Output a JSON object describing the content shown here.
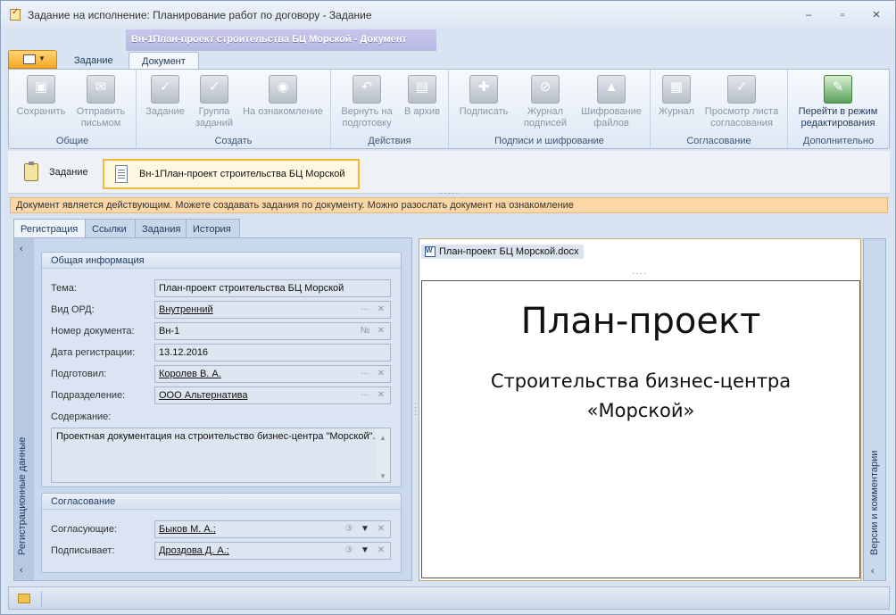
{
  "window": {
    "title": "Задание на исполнение: Планирование работ по договору - Задание",
    "controls": [
      "‒",
      "▫",
      "✕"
    ]
  },
  "context_tab": {
    "title": "Вн-1План-проект строительства БЦ Морской - Документ"
  },
  "ribbon_tabs": [
    "Задание",
    "Документ"
  ],
  "ribbon": {
    "groups": [
      {
        "label": "Общие",
        "buttons": [
          "Сохранить",
          "Отправить письмом"
        ]
      },
      {
        "label": "Создать",
        "buttons": [
          "Задание",
          "Группа заданий",
          "На ознакомление"
        ]
      },
      {
        "label": "Действия",
        "buttons": [
          "Вернуть на подготовку",
          "В архив"
        ]
      },
      {
        "label": "Подписи и шифрование",
        "buttons": [
          "Подписать",
          "Журнал подписей",
          "Шифрование файлов"
        ]
      },
      {
        "label": "Согласование",
        "buttons": [
          "Журнал",
          "Просмотр листа согласования"
        ]
      },
      {
        "label": "Дополнительно",
        "buttons": [
          "Перейти в режим редактирования"
        ]
      }
    ]
  },
  "breadcrumbs": {
    "task": "Задание",
    "document": "Вн-1План-проект строительства БЦ Морской"
  },
  "info_message": "Документ является действующим. Можете создавать задания по документу. Можно разослать документ на ознакомление",
  "form_tabs": [
    "Регистрация",
    "Ссылки",
    "Задания",
    "История"
  ],
  "side_label": "Регистрационные данные",
  "general": {
    "header": "Общая информация",
    "fields": {
      "topic": {
        "label": "Тема:",
        "value": "План-проект строительства БЦ Морской"
      },
      "ord_type": {
        "label": "Вид ОРД:",
        "value": "Внутренний"
      },
      "doc_number": {
        "label": "Номер документа:",
        "value": "Вн-1",
        "btn": "№"
      },
      "reg_date": {
        "label": "Дата регистрации:",
        "value": "13.12.2016"
      },
      "prepared": {
        "label": "Подготовил:",
        "value": "Королев В. А."
      },
      "department": {
        "label": "Подразделение:",
        "value": "ООО Альтернатива"
      }
    },
    "content_label": "Содержание:",
    "content_value": "Проектная документация на строительство бизнес-центра \"Морской\"."
  },
  "approval": {
    "header": "Согласование",
    "approvers": {
      "label": "Согласующие:",
      "value": "Быков М. А.;"
    },
    "signer": {
      "label": "Подписывает:",
      "value": "Дроздова Д. А.;"
    }
  },
  "viewer": {
    "file_name": "План-проект БЦ Морской.docx",
    "heading": "План-проект",
    "subheading_line1": "Строительства бизнес-центра",
    "subheading_line2": "«Морской»"
  },
  "versions_label": "Версии и комментарии"
}
